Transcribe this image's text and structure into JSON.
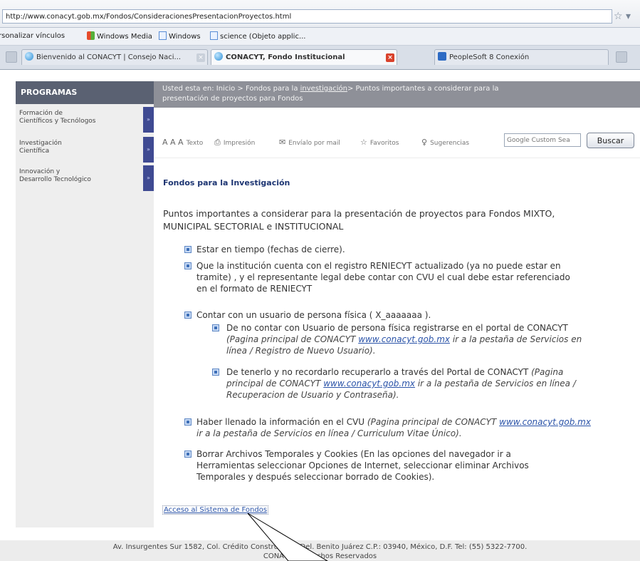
{
  "browser": {
    "url": "http://www.conacyt.gob.mx/Fondos/ConsideracionesPresentacionProyectos.html",
    "bookmarks": [
      "rsonalizar vínculos",
      "Windows Media",
      "Windows",
      "science (Objeto applic..."
    ],
    "tabs": [
      {
        "label": "Bienvenido al CONACYT | Consejo Naci..."
      },
      {
        "label": "CONACYT, Fondo Institucional",
        "active": true
      },
      {
        "label": "PeopleSoft 8 Conexión"
      }
    ]
  },
  "sidebar": {
    "title": "PROGRAMAS",
    "items": [
      {
        "line1": "Formación de",
        "line2": "Científicos y Tecnólogos"
      },
      {
        "line1": "Investigación",
        "line2": "Científica"
      },
      {
        "line1": "Innovación y",
        "line2": "Desarrollo Tecnológico"
      }
    ]
  },
  "breadcrumb": {
    "prefix": "Usted esta en: Inicio > Fondos para la ",
    "link": "investigación",
    "suffix": "> Puntos importantes a considerar para la",
    "line2": "presentación de proyectos para Fondos"
  },
  "tools": {
    "text": "Texto",
    "print": "Impresión",
    "email": "Envíalo por mail",
    "favorites": "Favoritos",
    "suggestions": "Sugerencias",
    "search_placeholder": "Google Custom Sea",
    "search_button": "Buscar"
  },
  "main": {
    "title": "Fondos para la Investigación",
    "intro_l1": "Puntos importantes a considerar para la presentación de proyectos para Fondos MIXTO,",
    "intro_l2": "MUNICIPAL SECTORIAL e INSTITUCIONAL",
    "b1": "Estar en tiempo (fechas de cierre).",
    "b2_l1": "Que la institución cuenta con el registro RENIECYT actualizado (ya no puede estar en",
    "b2_l2": "tramite) , y el representante legal debe contar con CVU el cual debe estar referenciado",
    "b2_l3": "en el formato de RENIECYT",
    "b3": "Contar con un usuario de persona física ( X_aaaaaaa ).",
    "b3a_l1": "De no contar con Usuario de persona física registrarse en el portal de CONACYT",
    "b3a_i1": "(Pagina principal de CONACYT ",
    "b3a_link": "www.conacyt.gob.mx",
    "b3a_i2": " ir a la pestaña de Servicios en",
    "b3a_l3": "línea / Registro de Nuevo Usuario).",
    "b3b_l1": "De tenerlo y no recordarlo recuperarlo a través del Portal de CONACYT ",
    "b3b_l1i": "(Pagina",
    "b3b_i1": "principal de CONACYT ",
    "b3b_link": "www.conacyt.gob.mx",
    "b3b_i2": " ir a la pestaña de Servicios en línea /",
    "b3b_l3": "Recuperacion de Usuario y Contraseña).",
    "b4_l1": "Haber llenado la información en el CVU ",
    "b4_l1i": "(Pagina principal de CONACYT ",
    "b4_link": "www.conacyt.gob.mx",
    "b4_l2": "ir a la pestaña de Servicios en línea / Curriculum Vitae Único).",
    "b5_l1": "Borrar Archivos Temporales y Cookies (En las opciones del navegador ir a",
    "b5_l2": "Herramientas seleccionar Opciones de Internet, seleccionar eliminar Archivos",
    "b5_l3": "Temporales y después seleccionar borrado de Cookies).",
    "access_link": "Acceso al Sistema de Fondos"
  },
  "footer": {
    "l1": "Av. Insurgentes Sur 1582, Col. Crédito Constructivo, Del. Benito Juárez C.P.: 03940, México, D.F. Tel: (55) 5322-7700.",
    "l2": "CONACYT Derechos Reservados"
  },
  "colors": {
    "sidebar_header": "#5a6172",
    "nav_arrow": "#3f4a92",
    "breadcrumb": "#8e9098",
    "title": "#1d3572",
    "link": "#2a53a8"
  }
}
